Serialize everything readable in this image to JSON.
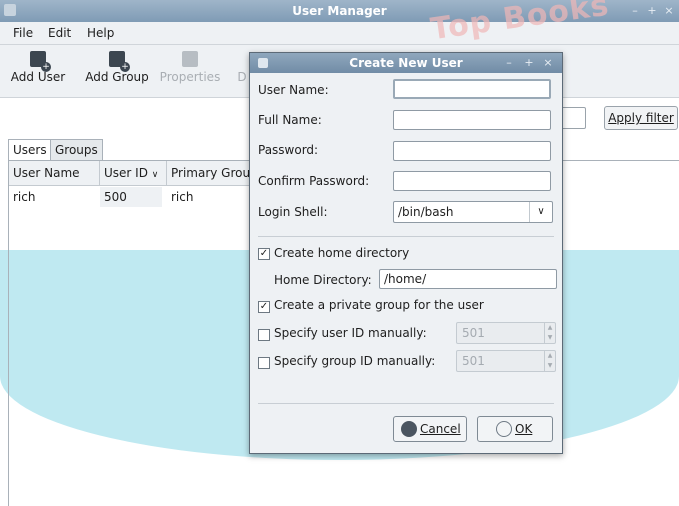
{
  "watermark": {
    "text": "Top Books"
  },
  "window": {
    "title": "User Manager",
    "controls": [
      "–",
      "+",
      "×"
    ]
  },
  "menubar": {
    "file": "File",
    "edit": "Edit",
    "help": "Help"
  },
  "toolbar": {
    "add_user": "Add User",
    "add_group": "Add Group",
    "properties": "Properties",
    "delete_partial": "D"
  },
  "filter": {
    "apply_label": "Apply filter",
    "value": ""
  },
  "tabs": {
    "users": "Users",
    "groups": "Groups"
  },
  "table": {
    "headers": {
      "user_name": "User Name",
      "user_id": "User ID",
      "primary_group": "Primary Group"
    },
    "rows": [
      {
        "user_name": "rich",
        "user_id": "500",
        "primary_group": "rich"
      }
    ]
  },
  "dialog": {
    "title": "Create New User",
    "controls": [
      "–",
      "+",
      "×"
    ],
    "user_name_label": "User Name:",
    "full_name_label": "Full Name:",
    "password_label": "Password:",
    "confirm_password_label": "Confirm Password:",
    "login_shell_label": "Login Shell:",
    "user_name_value": "",
    "full_name_value": "",
    "password_value": "",
    "confirm_password_value": "",
    "login_shell_value": "/bin/bash",
    "create_home_label": "Create home directory",
    "create_home_checked": true,
    "home_dir_label": "Home Directory:",
    "home_dir_value": "/home/",
    "private_group_label": "Create a private group for the user",
    "private_group_checked": true,
    "specify_uid_label": "Specify user ID manually:",
    "specify_uid_checked": false,
    "uid_value": "501",
    "specify_gid_label": "Specify group ID manually:",
    "specify_gid_checked": false,
    "gid_value": "501",
    "cancel_label": "Cancel",
    "ok_label": "OK"
  },
  "colors": {
    "titlebar": "#8fa7bd",
    "watermark_cyan": "#bfe9f1",
    "watermark_red": "#f3c8c8"
  }
}
